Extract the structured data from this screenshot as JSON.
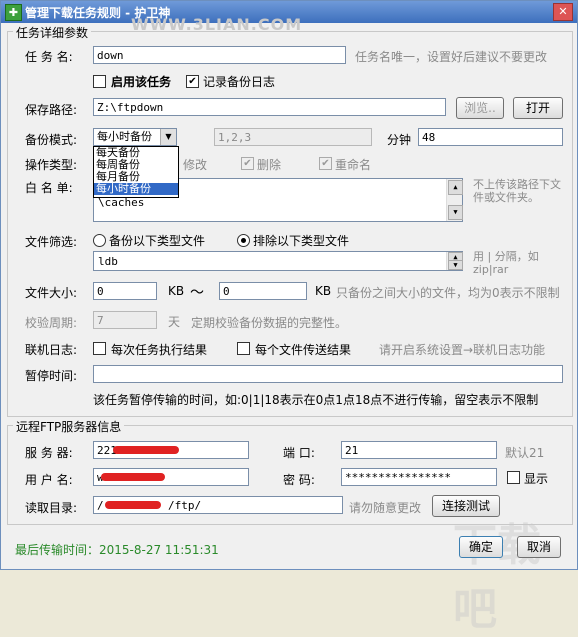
{
  "window": {
    "title": "管理下载任务规则 - 护卫神",
    "close_glyph": "✕"
  },
  "watermark_top": "WWW.3LIAN.COM",
  "watermark_bottom": "下载吧",
  "task_group": {
    "legend": "任务详细参数",
    "name_label": "任 务 名:",
    "name_value": "down",
    "name_hint": "任务名唯一，设置好后建议不要更改",
    "enable_label": "启用该任务",
    "log_label": "记录备份日志",
    "path_label": "保存路径:",
    "path_value": "Z:\\ftpdown",
    "browse_label": "浏览..",
    "open_label": "打开",
    "mode_label": "备份模式:",
    "mode_value": "每小时备份",
    "mode_options": [
      "每天备份",
      "每周备份",
      "每月备份",
      "每小时备份"
    ],
    "day_value": "1,2,3",
    "minute_label": "分钟",
    "minute_value": "48",
    "op_label": "操作类型:",
    "op_modify": "修改",
    "op_delete": "删除",
    "op_rename": "重命名",
    "white_label": "白 名 单:",
    "white_value": "\\caches",
    "white_hint": "不上传该路径下文件或文件夹。",
    "filter_label": "文件筛选:",
    "filter_backup": "备份以下类型文件",
    "filter_exclude": "排除以下类型文件",
    "filter_value": "ldb",
    "filter_hint": "用 | 分隔，如zip|rar",
    "size_label": "文件大小:",
    "size_min": "0",
    "size_unit1": "KB",
    "tilde": "～",
    "size_max": "0",
    "size_unit2": "KB",
    "size_hint": "只备份之间大小的文件，均为0表示不限制",
    "verify_label": "校验周期:",
    "verify_value": "7",
    "verify_unit": "天",
    "verify_hint": "定期校验备份数据的完整性。",
    "linklog_label": "联机日志:",
    "linklog_task": "每次任务执行结果",
    "linklog_file": "每个文件传送结果",
    "linklog_hint": "请开启系统设置→联机日志功能",
    "pause_label": "暂停时间:",
    "pause_value": "",
    "pause_hint": "该任务暂停传输的时间，如:0|1|18表示在0点1点18点不进行传输，留空表示不限制"
  },
  "ftp_group": {
    "legend": "远程FTP服务器信息",
    "server_label": "服 务 器:",
    "server_value": "221.",
    "port_label": "端    口:",
    "port_value": "21",
    "port_hint": "默认21",
    "user_label": "用 户 名:",
    "user_value": "w",
    "pwd_label": "密    码:",
    "pwd_value": "****************",
    "show_label": "显示",
    "dir_label": "读取目录:",
    "dir_value": "/",
    "dir_value_tail": "/ftp/",
    "dir_hint": "请勿随意更改",
    "test_label": "连接测试"
  },
  "status": "最后传输时间：2015-8-27 11:51:31",
  "ok_label": "确定",
  "cancel_label": "取消",
  "colors": {
    "accent": "#3169c6",
    "status_green": "#2a8a2a",
    "redaction": "#e02222"
  }
}
